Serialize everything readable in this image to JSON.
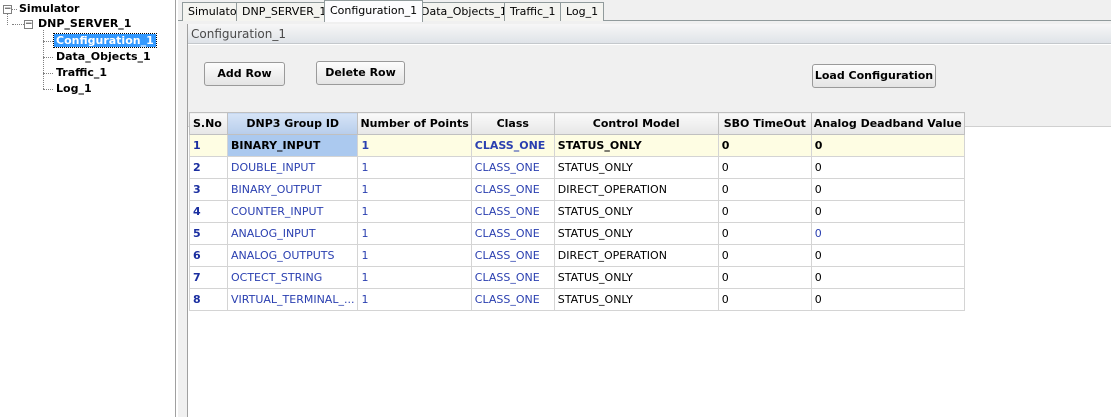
{
  "tree": {
    "root": "Simulator",
    "server": "DNP_SERVER_1",
    "children": [
      "Configuration_1",
      "Data_Objects_1",
      "Traffic_1",
      "Log_1"
    ],
    "selected": "Configuration_1"
  },
  "tabs": [
    "Simulator",
    "DNP_SERVER_1",
    "Configuration_1",
    "Data_Objects_1",
    "Traffic_1",
    "Log_1"
  ],
  "active_tab": "Configuration_1",
  "panel": {
    "title": "Configuration_1",
    "add_row": "Add Row",
    "delete_row": "Delete Row",
    "load_configuration": "Load Configuration"
  },
  "grid": {
    "headers": [
      "S.No",
      "DNP3 Group ID",
      "Number of Points",
      "Class",
      "Control Model",
      "SBO TimeOut",
      "Analog Deadband Value"
    ],
    "rows": [
      [
        "1",
        "BINARY_INPUT",
        "1",
        "CLASS_ONE",
        "STATUS_ONLY",
        "0",
        "0"
      ],
      [
        "2",
        "DOUBLE_INPUT",
        "1",
        "CLASS_ONE",
        "STATUS_ONLY",
        "0",
        "0"
      ],
      [
        "3",
        "BINARY_OUTPUT",
        "1",
        "CLASS_ONE",
        "DIRECT_OPERATION",
        "0",
        "0"
      ],
      [
        "4",
        "COUNTER_INPUT",
        "1",
        "CLASS_ONE",
        "STATUS_ONLY",
        "0",
        "0"
      ],
      [
        "5",
        "ANALOG_INPUT",
        "1",
        "CLASS_ONE",
        "STATUS_ONLY",
        "0",
        "0"
      ],
      [
        "6",
        "ANALOG_OUTPUTS",
        "1",
        "CLASS_ONE",
        "DIRECT_OPERATION",
        "0",
        "0"
      ],
      [
        "7",
        "OCTECT_STRING",
        "1",
        "CLASS_ONE",
        "STATUS_ONLY",
        "0",
        "0"
      ],
      [
        "8",
        "VIRTUAL_TERMINAL_...",
        "1",
        "CLASS_ONE",
        "STATUS_ONLY",
        "0",
        "0"
      ]
    ],
    "selected_row": 1
  }
}
